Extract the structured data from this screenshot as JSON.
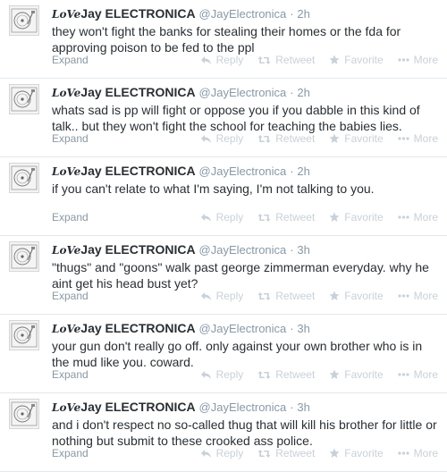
{
  "tweets": [
    {
      "author_prefix": "LoVe",
      "author_name": "Jay ELECTRONICA",
      "handle": "@JayElectronica",
      "separator": "·",
      "time": "2h",
      "text": "they won't fight the banks for stealing their homes or the fda for approving poison to be fed to the ppl",
      "expand": "Expand",
      "reply": "Reply",
      "retweet": "Retweet",
      "favorite": "Favorite",
      "more": "More"
    },
    {
      "author_prefix": "LoVe",
      "author_name": "Jay ELECTRONICA",
      "handle": "@JayElectronica",
      "separator": "·",
      "time": "2h",
      "text": "whats sad is pp will fight or oppose you if you dabble in this kind of talk.. but they won't fight the school for teaching the babies lies.",
      "expand": "Expand",
      "reply": "Reply",
      "retweet": "Retweet",
      "favorite": "Favorite",
      "more": "More"
    },
    {
      "author_prefix": "LoVe",
      "author_name": "Jay ELECTRONICA",
      "handle": "@JayElectronica",
      "separator": "·",
      "time": "2h",
      "text": "if you can't relate to what I'm saying, I'm not talking to you.",
      "expand": "Expand",
      "reply": "Reply",
      "retweet": "Retweet",
      "favorite": "Favorite",
      "more": "More"
    },
    {
      "author_prefix": "LoVe",
      "author_name": "Jay ELECTRONICA",
      "handle": "@JayElectronica",
      "separator": "·",
      "time": "3h",
      "text": "\"thugs\" and \"goons\" walk past george zimmerman everyday. why he aint get his head bust yet?",
      "expand": "Expand",
      "reply": "Reply",
      "retweet": "Retweet",
      "favorite": "Favorite",
      "more": "More"
    },
    {
      "author_prefix": "LoVe",
      "author_name": "Jay ELECTRONICA",
      "handle": "@JayElectronica",
      "separator": "·",
      "time": "3h",
      "text": "your gun don't really go off. only against your own brother who is in the mud like you. coward.",
      "expand": "Expand",
      "reply": "Reply",
      "retweet": "Retweet",
      "favorite": "Favorite",
      "more": "More"
    },
    {
      "author_prefix": "LoVe",
      "author_name": "Jay ELECTRONICA",
      "handle": "@JayElectronica",
      "separator": "·",
      "time": "3h",
      "text": "and i don't respect no so-called thug that will kill his brother for little or nothing but submit to these crooked ass police.",
      "expand": "Expand",
      "reply": "Reply",
      "retweet": "Retweet",
      "favorite": "Favorite",
      "more": "More"
    }
  ],
  "colors": {
    "text": "#292f33",
    "meta": "#8899a6",
    "action_icon": "#c8d1d8",
    "divider": "#e1e8ed"
  },
  "icons": {
    "avatar": "turntable-avatar",
    "reply": "reply-icon",
    "retweet": "retweet-icon",
    "favorite": "star-icon",
    "more": "ellipsis-icon"
  }
}
